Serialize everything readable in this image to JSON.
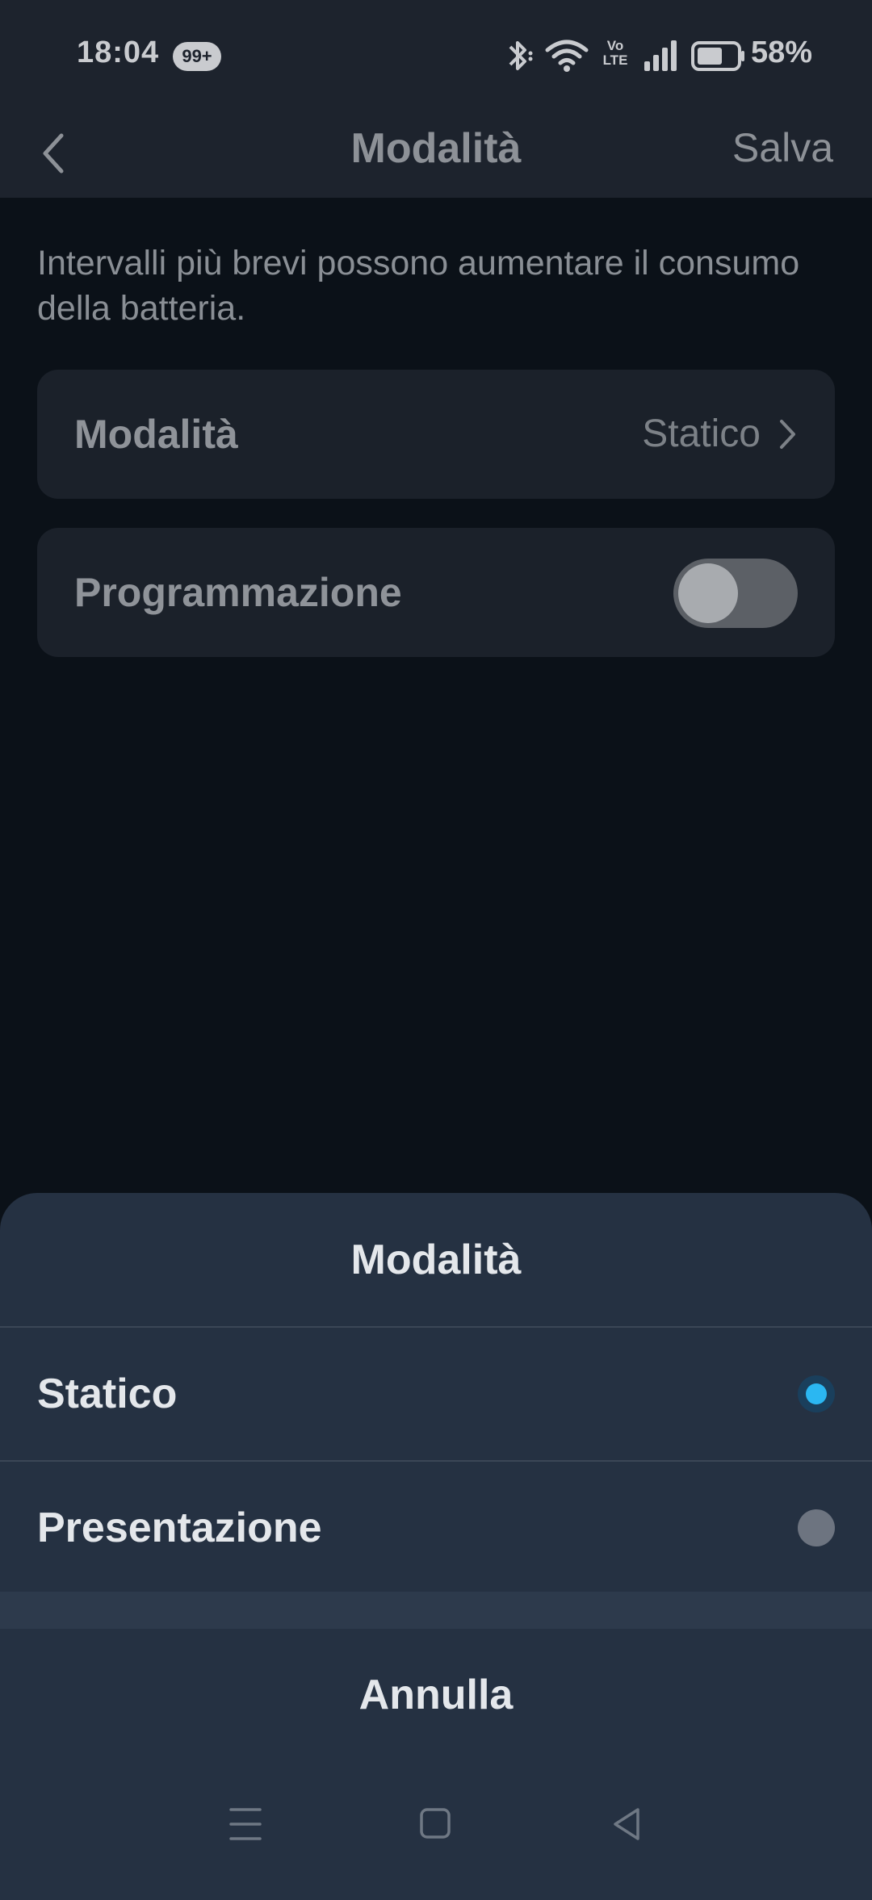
{
  "status_bar": {
    "time": "18:04",
    "notification_badge": "99+",
    "network_label_top": "Vo",
    "network_label_bottom": "LTE",
    "battery_percent": "58%",
    "icons": [
      "bluetooth-icon",
      "wifi-icon",
      "volte-icon",
      "signal-icon",
      "battery-icon"
    ]
  },
  "header": {
    "title": "Modalità",
    "save_label": "Salva",
    "back_icon": "chevron-left-icon"
  },
  "hint_text": "Intervalli più brevi possono aumentare il consumo della batteria.",
  "settings": {
    "mode": {
      "label": "Modalità",
      "value": "Statico"
    },
    "schedule": {
      "label": "Programmazione",
      "enabled": false
    }
  },
  "sheet": {
    "title": "Modalità",
    "options": [
      {
        "label": "Statico",
        "selected": true
      },
      {
        "label": "Presentazione",
        "selected": false
      }
    ],
    "cancel_label": "Annulla"
  },
  "colors": {
    "accent": "#2bb7f2",
    "sheet_background": "#253142",
    "page_background": "#0b1118"
  },
  "nav_bar": [
    "menu-icon",
    "home-icon",
    "back-triangle-icon"
  ]
}
